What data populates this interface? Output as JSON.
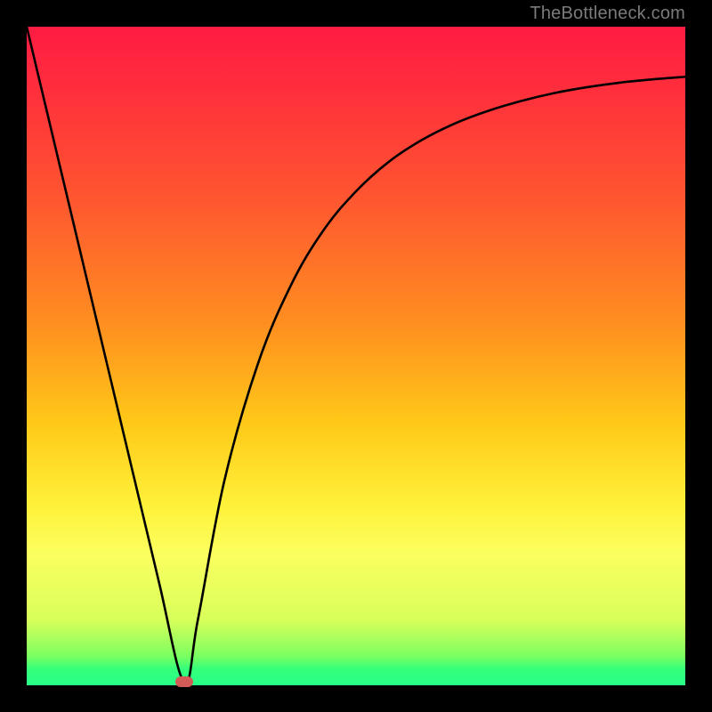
{
  "watermark": "TheBottleneck.com",
  "chart_data": {
    "type": "line",
    "title": "",
    "xlabel": "",
    "ylabel": "",
    "xlim": [
      0,
      100
    ],
    "ylim": [
      0,
      100
    ],
    "grid": false,
    "legend": false,
    "series": [
      {
        "name": "curve",
        "x": [
          0,
          5,
          10,
          15,
          20,
          23.9,
          26,
          30,
          35,
          40,
          45,
          50,
          55,
          60,
          65,
          70,
          75,
          80,
          85,
          90,
          95,
          100
        ],
        "y": [
          100,
          79,
          58,
          37,
          16,
          0.5,
          10,
          31,
          48.5,
          60.5,
          69,
          75,
          79.5,
          82.8,
          85.3,
          87.2,
          88.7,
          89.9,
          90.8,
          91.5,
          92,
          92.4
        ]
      }
    ],
    "marker": {
      "x": 23.9,
      "y": 0.6
    },
    "gradient_stops": [
      {
        "pos": 0,
        "color": "#ff1c42"
      },
      {
        "pos": 0.25,
        "color": "#ff5331"
      },
      {
        "pos": 0.45,
        "color": "#ff8e20"
      },
      {
        "pos": 0.6,
        "color": "#ffc818"
      },
      {
        "pos": 0.8,
        "color": "#fbff5f"
      },
      {
        "pos": 0.95,
        "color": "#7dff60"
      },
      {
        "pos": 1.0,
        "color": "#27ff88"
      }
    ]
  }
}
